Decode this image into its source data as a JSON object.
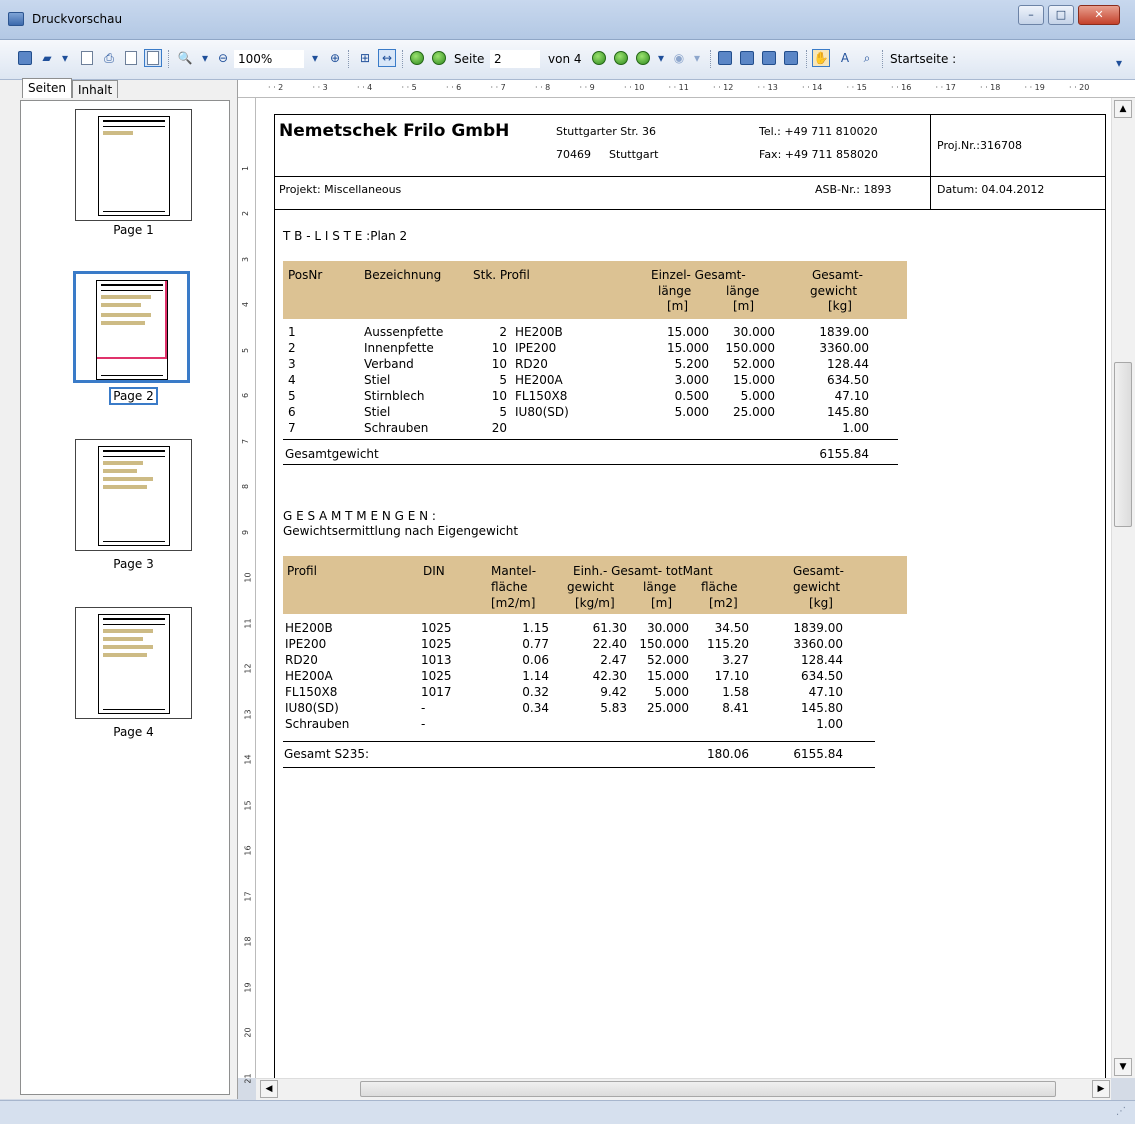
{
  "window": {
    "title": "Druckvorschau",
    "min": "–",
    "max": "□",
    "close": "✕"
  },
  "toolbar": {
    "zoom": "100%",
    "page_label": "Seite",
    "page_value": "2",
    "of_label": "von 4",
    "start_label": "Startseite :",
    "more": "▾"
  },
  "sidebar": {
    "tabs": [
      "Seiten",
      "Inhalt"
    ],
    "pages": [
      "Page 1",
      "Page 2",
      "Page 3",
      "Page 4"
    ],
    "selected_page": 2
  },
  "doc": {
    "company": "Nemetschek Frilo GmbH",
    "street": "Stuttgarter Str. 36",
    "zip": "70469",
    "city": "Stuttgart",
    "tel": "Tel.: +49 711 810020",
    "fax": "Fax: +49 711 858020",
    "proj": "Proj.Nr.:316708",
    "projekt": "Projekt: Miscellaneous",
    "asb": "ASB-Nr.: 1893",
    "datum": "Datum: 04.04.2012",
    "tb_title": "T B - L I S T E :Plan 2",
    "tb_headers": {
      "posnr": "PosNr",
      "bez": "Bezeichnung",
      "stk": "Stk. Profil",
      "einzel1": "Einzel- Gesamt-",
      "laenge1": "länge",
      "laenge2": "länge",
      "m1": "[m]",
      "m2": "[m]",
      "gesamt1": "Gesamt-",
      "gewicht1": "gewicht",
      "kg1": "[kg]"
    },
    "tb_rows": [
      {
        "pos": "1",
        "bez": "Aussenpfette",
        "stk": "2",
        "profil": "HE200B",
        "einzel": "15.000",
        "gesamt": "30.000",
        "gewicht": "1839.00"
      },
      {
        "pos": "2",
        "bez": "Innenpfette",
        "stk": "10",
        "profil": "IPE200",
        "einzel": "15.000",
        "gesamt": "150.000",
        "gewicht": "3360.00"
      },
      {
        "pos": "3",
        "bez": "Verband",
        "stk": "10",
        "profil": "RD20",
        "einzel": "5.200",
        "gesamt": "52.000",
        "gewicht": "128.44"
      },
      {
        "pos": "4",
        "bez": "Stiel",
        "stk": "5",
        "profil": "HE200A",
        "einzel": "3.000",
        "gesamt": "15.000",
        "gewicht": "634.50"
      },
      {
        "pos": "5",
        "bez": "Stirnblech",
        "stk": "10",
        "profil": "FL150X8",
        "einzel": "0.500",
        "gesamt": "5.000",
        "gewicht": "47.10"
      },
      {
        "pos": "6",
        "bez": "Stiel",
        "stk": "5",
        "profil": "IU80(SD)",
        "einzel": "5.000",
        "gesamt": "25.000",
        "gewicht": "145.80"
      },
      {
        "pos": "7",
        "bez": "Schrauben",
        "stk": "20",
        "profil": "",
        "einzel": "",
        "gesamt": "",
        "gewicht": "1.00"
      }
    ],
    "tb_total_label": "Gesamtgewicht",
    "tb_total_value": "6155.84",
    "gm_title": "G E S A M T M E N G E N :",
    "gm_subtitle": "Gewichtsermittlung nach Eigengewicht",
    "gm_headers": {
      "profil": "Profil",
      "din": "DIN",
      "mantel": "Mantel-",
      "flaeche": "fläche",
      "m2m": "[m2/m]",
      "einh": "Einh.- Gesamt- totMant",
      "gewicht": "gewicht",
      "laenge": "länge",
      "flaeche2": "fläche",
      "kgm": "[kg/m]",
      "m": "[m]",
      "m2": "[m2]",
      "gesamt": "Gesamt-",
      "gewicht2": "gewicht",
      "kg": "[kg]"
    },
    "gm_rows": [
      {
        "profil": "HE200B",
        "din": "1025",
        "mantel": "1.15",
        "einh": "61.30",
        "laenge": "30.000",
        "tot": "34.50",
        "gewicht": "1839.00"
      },
      {
        "profil": "IPE200",
        "din": "1025",
        "mantel": "0.77",
        "einh": "22.40",
        "laenge": "150.000",
        "tot": "115.20",
        "gewicht": "3360.00"
      },
      {
        "profil": "RD20",
        "din": "1013",
        "mantel": "0.06",
        "einh": "2.47",
        "laenge": "52.000",
        "tot": "3.27",
        "gewicht": "128.44"
      },
      {
        "profil": "HE200A",
        "din": "1025",
        "mantel": "1.14",
        "einh": "42.30",
        "laenge": "15.000",
        "tot": "17.10",
        "gewicht": "634.50"
      },
      {
        "profil": "FL150X8",
        "din": "1017",
        "mantel": "0.32",
        "einh": "9.42",
        "laenge": "5.000",
        "tot": "1.58",
        "gewicht": "47.10"
      },
      {
        "profil": "IU80(SD)",
        "din": "-",
        "mantel": "0.34",
        "einh": "5.83",
        "laenge": "25.000",
        "tot": "8.41",
        "gewicht": "145.80"
      },
      {
        "profil": "Schrauben",
        "din": "-",
        "mantel": "",
        "einh": "",
        "laenge": "",
        "tot": "",
        "gewicht": "1.00"
      }
    ],
    "gm_total_label": "Gesamt S235:",
    "gm_total_tot": "180.06",
    "gm_total_value": "6155.84"
  }
}
